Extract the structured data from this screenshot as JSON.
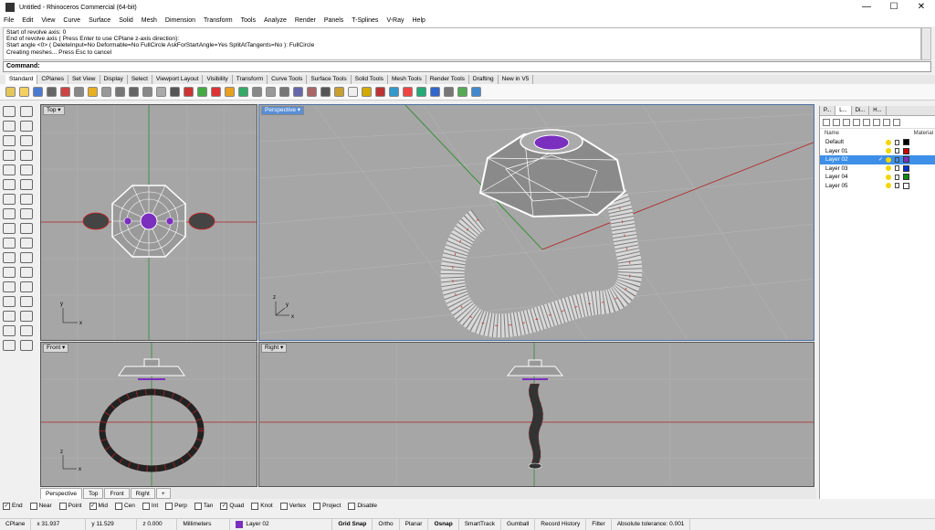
{
  "window": {
    "title": "Untitled - Rhinoceros Commercial (64-bit)",
    "minimize": "—",
    "maximize": "☐",
    "close": "✕"
  },
  "menu": [
    "File",
    "Edit",
    "View",
    "Curve",
    "Surface",
    "Solid",
    "Mesh",
    "Dimension",
    "Transform",
    "Tools",
    "Analyze",
    "Render",
    "Panels",
    "T-Splines",
    "V-Ray",
    "Help"
  ],
  "command_history": [
    "Start of revolve axis: 0",
    "End of revolve axis ( Press Enter to use CPlane z-axis direction):",
    "Start angle <0> ( DeleteInput=No  Deformable=No  FullCircle  AskForStartAngle=Yes  SplitAtTangents=No ): FullCircle",
    "Creating meshes... Press Esc to cancel"
  ],
  "command_prompt": "Command:",
  "toolbar_tabs": [
    "Standard",
    "CPlanes",
    "Set View",
    "Display",
    "Select",
    "Viewport Layout",
    "Visibility",
    "Transform",
    "Curve Tools",
    "Surface Tools",
    "Solid Tools",
    "Mesh Tools",
    "Render Tools",
    "Drafting",
    "New in V5"
  ],
  "toolbar_icon_colors": [
    "#e6c85a",
    "#f5d060",
    "#4a7bd0",
    "#666",
    "#c44",
    "#888",
    "#e8b020",
    "#999",
    "#777",
    "#666",
    "#888",
    "#aaa",
    "#555",
    "#c33",
    "#4a4",
    "#d33",
    "#e9a020",
    "#3a6",
    "#888",
    "#999",
    "#777",
    "#66a",
    "#a66",
    "#555",
    "#c9a030",
    "#eee",
    "#d4aa00",
    "#b33",
    "#39c",
    "#e44",
    "#2a7",
    "#36c",
    "#777",
    "#5a5",
    "#48c"
  ],
  "viewports": {
    "top": {
      "label": "Top",
      "axis_x": "x",
      "axis_y": "y"
    },
    "perspective": {
      "label": "Perspective",
      "axis_x": "x",
      "axis_y": "y",
      "axis_z": "z"
    },
    "front": {
      "label": "Front",
      "axis_x": "x",
      "axis_y": "z"
    },
    "right": {
      "label": "Right",
      "axis_x": "y",
      "axis_y": "z"
    }
  },
  "viewport_tabs": [
    "Perspective",
    "Top",
    "Front",
    "Right",
    "+"
  ],
  "panel": {
    "tabs": [
      "P...",
      "L...",
      "Di...",
      "H..."
    ],
    "col_name": "Name",
    "col_material": "Material",
    "layers": [
      {
        "name": "Default",
        "color": "#000000",
        "selected": false,
        "current": false
      },
      {
        "name": "Layer 01",
        "color": "#cc0000",
        "selected": false,
        "current": false
      },
      {
        "name": "Layer 02",
        "color": "#7b2fbe",
        "selected": true,
        "current": true
      },
      {
        "name": "Layer 03",
        "color": "#0033cc",
        "selected": false,
        "current": false
      },
      {
        "name": "Layer 04",
        "color": "#118811",
        "selected": false,
        "current": false
      },
      {
        "name": "Layer 05",
        "color": "#ffffff",
        "selected": false,
        "current": false
      }
    ],
    "current_mark": "✓"
  },
  "osnaps": [
    {
      "label": "End",
      "checked": true
    },
    {
      "label": "Near",
      "checked": false
    },
    {
      "label": "Point",
      "checked": false
    },
    {
      "label": "Mid",
      "checked": true
    },
    {
      "label": "Cen",
      "checked": false
    },
    {
      "label": "Int",
      "checked": false
    },
    {
      "label": "Perp",
      "checked": false
    },
    {
      "label": "Tan",
      "checked": false
    },
    {
      "label": "Quad",
      "checked": true
    },
    {
      "label": "Knot",
      "checked": false
    },
    {
      "label": "Vertex",
      "checked": false
    },
    {
      "label": "Project",
      "checked": false
    },
    {
      "label": "Disable",
      "checked": false
    }
  ],
  "status": {
    "cplane": "CPlane",
    "x": "x 31.937",
    "y": "y 11.529",
    "z": "z 0.000",
    "units": "Millimeters",
    "layer": "Layer 02",
    "layer_color": "#7b2fbe",
    "toggles": [
      {
        "label": "Grid Snap",
        "on": true
      },
      {
        "label": "Ortho",
        "on": false
      },
      {
        "label": "Planar",
        "on": false
      },
      {
        "label": "Osnap",
        "on": true
      },
      {
        "label": "SmartTrack",
        "on": false
      },
      {
        "label": "Gumball",
        "on": false
      },
      {
        "label": "Record History",
        "on": false
      },
      {
        "label": "Filter",
        "on": false
      }
    ],
    "tolerance": "Absolute tolerance: 0.001"
  },
  "colors": {
    "viewport_bg": "#a6a6a6",
    "active_tab": "#5a8fd6",
    "selection": "#3d8fe8",
    "gem": "#7b2fbe",
    "axis_red": "#b22222",
    "axis_green": "#2e8b2e"
  }
}
